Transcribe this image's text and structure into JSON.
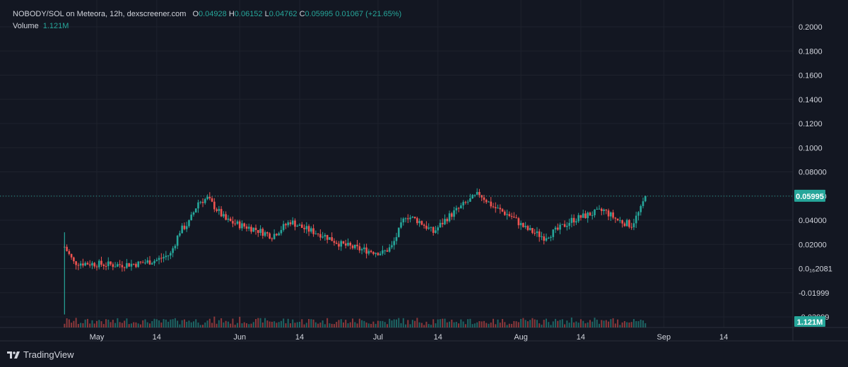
{
  "header": {
    "symbol": "NOBODY/SOL on Meteora, 12h, dexscreener.com",
    "open_label": "O",
    "open": "0.04928",
    "high_label": "H",
    "high": "0.06152",
    "low_label": "L",
    "low": "0.04762",
    "close_label": "C",
    "close": "0.05995",
    "change": "0.01067 (+21.65%)",
    "volume_label": "Volume",
    "volume": "1.121M"
  },
  "brand": {
    "name": "TradingView"
  },
  "colors": {
    "up": "#26a69a",
    "down": "#ef5350",
    "background": "#131722",
    "grid": "#1e222d",
    "text": "#d1d4dc"
  },
  "chart_data": {
    "type": "candlestick",
    "price_axis_ticks": [
      "0.2000",
      "0.1800",
      "0.1600",
      "0.1400",
      "0.1200",
      "0.1000",
      "0.08000",
      "0.06000",
      "0.04000",
      "0.02000",
      "0.0₁₆2081",
      "-0.01999",
      "-0.03999"
    ],
    "ylim": [
      -0.04,
      0.21
    ],
    "time_axis_ticks": [
      "May",
      "14",
      "Jun",
      "14",
      "Jul",
      "14",
      "Aug",
      "14",
      "Sep",
      "14"
    ],
    "time_tick_dates": [
      "2024-05-01",
      "2024-05-14",
      "2024-06-01",
      "2024-06-14",
      "2024-07-01",
      "2024-07-14",
      "2024-08-01",
      "2024-08-14",
      "2024-09-01",
      "2024-09-14"
    ],
    "xlim": [
      "2024-04-10",
      "2024-09-29"
    ],
    "last_price": "0.05995",
    "last_volume": "1.121M",
    "close_series": [
      {
        "date": "2024-04-24",
        "close": 0.018
      },
      {
        "date": "2024-04-26",
        "close": 0.005
      },
      {
        "date": "2024-04-30",
        "close": 0.004
      },
      {
        "date": "2024-05-05",
        "close": 0.003
      },
      {
        "date": "2024-05-10",
        "close": 0.004
      },
      {
        "date": "2024-05-14",
        "close": 0.007
      },
      {
        "date": "2024-05-17",
        "close": 0.012
      },
      {
        "date": "2024-05-19",
        "close": 0.031
      },
      {
        "date": "2024-05-21",
        "close": 0.038
      },
      {
        "date": "2024-05-23",
        "close": 0.055
      },
      {
        "date": "2024-05-25",
        "close": 0.058
      },
      {
        "date": "2024-05-29",
        "close": 0.04
      },
      {
        "date": "2024-06-01",
        "close": 0.036
      },
      {
        "date": "2024-06-04",
        "close": 0.033
      },
      {
        "date": "2024-06-08",
        "close": 0.027
      },
      {
        "date": "2024-06-12",
        "close": 0.039
      },
      {
        "date": "2024-06-15",
        "close": 0.033
      },
      {
        "date": "2024-06-19",
        "close": 0.028
      },
      {
        "date": "2024-06-23",
        "close": 0.02
      },
      {
        "date": "2024-06-27",
        "close": 0.016
      },
      {
        "date": "2024-07-02",
        "close": 0.013
      },
      {
        "date": "2024-07-04",
        "close": 0.018
      },
      {
        "date": "2024-07-07",
        "close": 0.044
      },
      {
        "date": "2024-07-10",
        "close": 0.039
      },
      {
        "date": "2024-07-13",
        "close": 0.03
      },
      {
        "date": "2024-07-16",
        "close": 0.042
      },
      {
        "date": "2024-07-20",
        "close": 0.054
      },
      {
        "date": "2024-07-23",
        "close": 0.062
      },
      {
        "date": "2024-07-26",
        "close": 0.051
      },
      {
        "date": "2024-07-30",
        "close": 0.043
      },
      {
        "date": "2024-08-02",
        "close": 0.033
      },
      {
        "date": "2024-08-06",
        "close": 0.026
      },
      {
        "date": "2024-08-09",
        "close": 0.032
      },
      {
        "date": "2024-08-12",
        "close": 0.04
      },
      {
        "date": "2024-08-16",
        "close": 0.045
      },
      {
        "date": "2024-08-19",
        "close": 0.048
      },
      {
        "date": "2024-08-22",
        "close": 0.04
      },
      {
        "date": "2024-08-25",
        "close": 0.036
      },
      {
        "date": "2024-08-27",
        "close": 0.049
      },
      {
        "date": "2024-08-28",
        "close": 0.05995
      }
    ]
  }
}
